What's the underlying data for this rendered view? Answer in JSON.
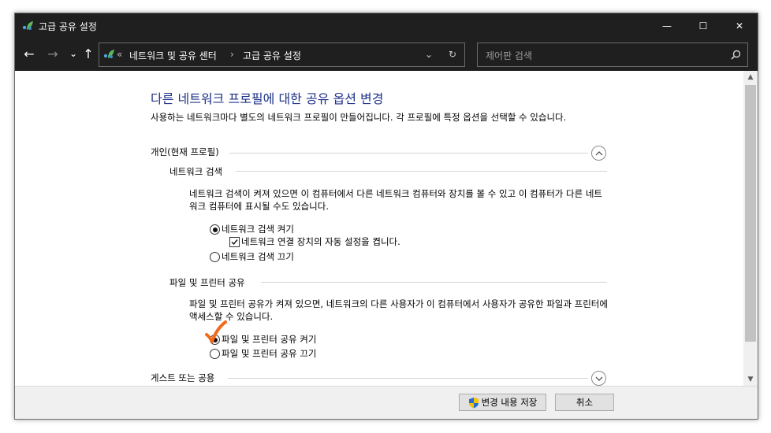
{
  "window": {
    "title": "고급 공유 설정",
    "controls": {
      "minimize": "—",
      "maximize": "☐",
      "close": "✕"
    }
  },
  "nav": {
    "back": "←",
    "forward": "→",
    "recent": "⌄",
    "up": "↑",
    "breadcrumb": {
      "overflow": "«",
      "parent": "네트워크 및 공유 센터",
      "separator": "›",
      "current": "고급 공유 설정"
    },
    "dropdown": "⌄",
    "refresh": "↻",
    "search_placeholder": "제어판 검색"
  },
  "content": {
    "heading": "다른 네트워크 프로필에 대한 공유 옵션 변경",
    "description": "사용하는 네트워크마다 별도의 네트워크 프로필이 만들어집니다. 각 프로필에 특정 옵션을 선택할 수 있습니다.",
    "private_profile": {
      "label": "개인(현재 프로필)",
      "network_discovery": {
        "label": "네트워크 검색",
        "description": "네트워크 검색이 켜져 있으면 이 컴퓨터에서 다른 네트워크 컴퓨터와 장치를 볼 수 있고 이 컴퓨터가 다른 네트워크 컴퓨터에 표시될 수도 있습니다.",
        "option_on": "네트워크 검색 켜기",
        "auto_setup": "네트워크 연결 장치의 자동 설정을 켭니다.",
        "option_off": "네트워크 검색 끄기",
        "selected": "on",
        "auto_setup_checked": true
      },
      "file_printer": {
        "label": "파일 및 프린터 공유",
        "description": "파일 및 프린터 공유가 켜져 있으면, 네트워크의 다른 사용자가 이 컴퓨터에서 사용자가 공유한 파일과 프린터에 액세스할 수 있습니다.",
        "option_on": "파일 및 프린터 공유 켜기",
        "option_off": "파일 및 프린터 공유 끄기",
        "selected": "on"
      }
    },
    "guest_profile": {
      "label": "게스트 또는 공용"
    }
  },
  "footer": {
    "save_label": "변경 내용 저장",
    "cancel_label": "취소"
  },
  "colors": {
    "titlebar": "#1f1f1f",
    "heading": "#1e3287",
    "annotation": "#f26a1b"
  }
}
